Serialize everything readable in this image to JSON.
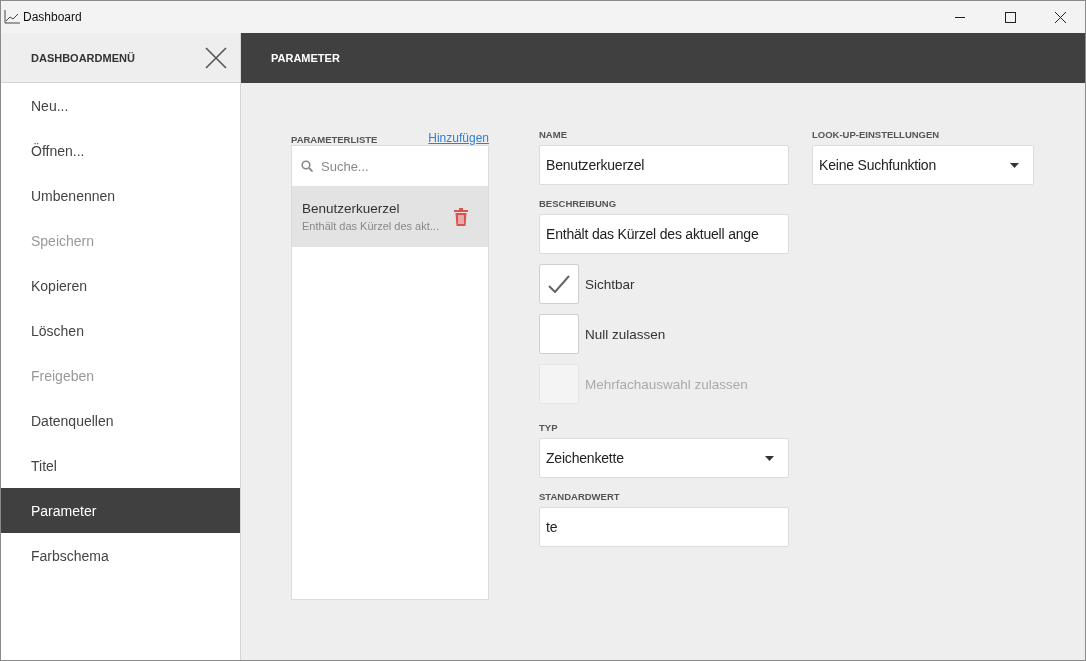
{
  "window": {
    "title": "Dashboard"
  },
  "sidebar": {
    "title": "DASHBOARDMENÜ",
    "items": [
      {
        "label": "Neu...",
        "disabled": false,
        "selected": false
      },
      {
        "label": "Öffnen...",
        "disabled": false,
        "selected": false
      },
      {
        "label": "Umbenennen",
        "disabled": false,
        "selected": false
      },
      {
        "label": "Speichern",
        "disabled": true,
        "selected": false
      },
      {
        "label": "Kopieren",
        "disabled": false,
        "selected": false
      },
      {
        "label": "Löschen",
        "disabled": false,
        "selected": false
      },
      {
        "label": "Freigeben",
        "disabled": true,
        "selected": false
      },
      {
        "label": "Datenquellen",
        "disabled": false,
        "selected": false
      },
      {
        "label": "Titel",
        "disabled": false,
        "selected": false
      },
      {
        "label": "Parameter",
        "disabled": false,
        "selected": true
      },
      {
        "label": "Farbschema",
        "disabled": false,
        "selected": false
      }
    ]
  },
  "header": {
    "title": "PARAMETER"
  },
  "parameter_list": {
    "label": "PARAMETERLISTE",
    "add_link": "Hinzufügen",
    "search": {
      "placeholder": "Suche..."
    },
    "items": [
      {
        "name": "Benutzerkuerzel",
        "description": "Enthält das Kürzel des akt...",
        "selected": true
      }
    ]
  },
  "form": {
    "name": {
      "label": "NAME",
      "value": "Benutzerkuerzel"
    },
    "description": {
      "label": "BESCHREIBUNG",
      "value": "Enthält das Kürzel des aktuell ange"
    },
    "checkboxes": [
      {
        "label": "Sichtbar",
        "checked": true,
        "disabled": false
      },
      {
        "label": "Null zulassen",
        "checked": false,
        "disabled": false
      },
      {
        "label": "Mehrfachauswahl zulassen",
        "checked": false,
        "disabled": true
      }
    ],
    "type": {
      "label": "TYP",
      "value": "Zeichenkette"
    },
    "default_value": {
      "label": "STANDARDWERT",
      "value": "te"
    }
  },
  "lookup": {
    "label": "LOOK-UP-EINSTELLUNGEN",
    "value": "Keine Suchfunktion"
  }
}
